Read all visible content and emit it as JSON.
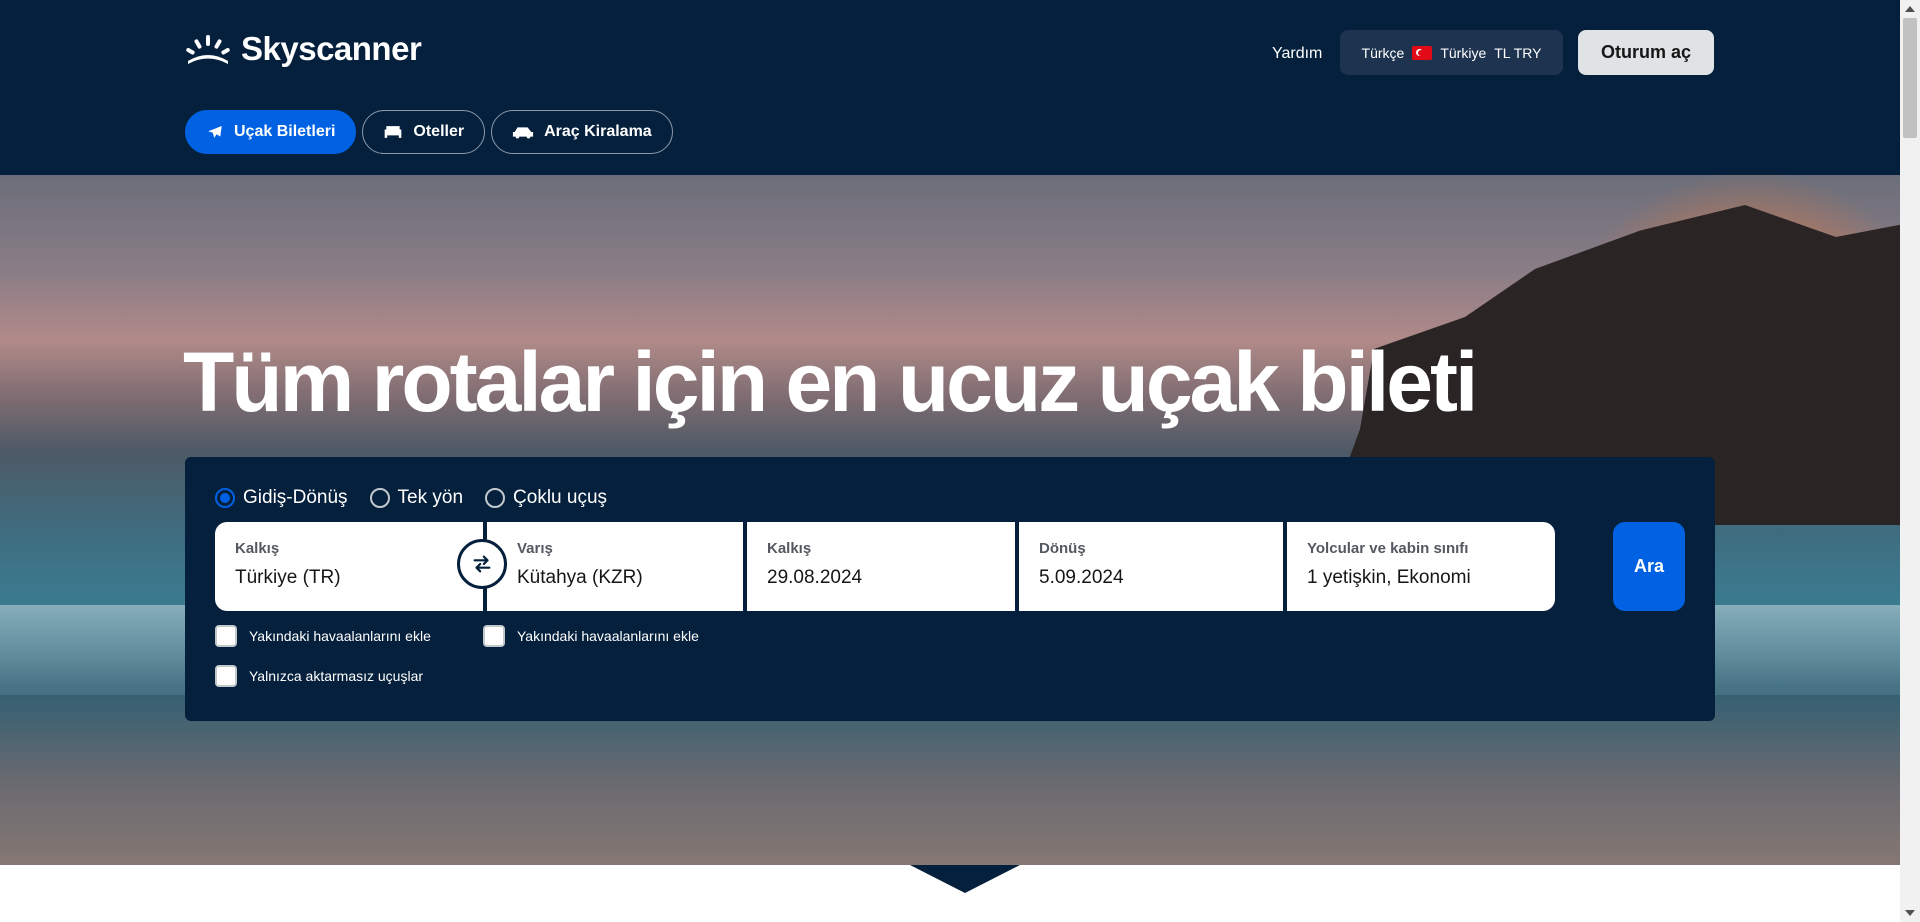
{
  "header": {
    "brand": "Skyscanner",
    "help_label": "Yardım",
    "locale": {
      "language": "Türkçe",
      "country": "Türkiye",
      "currency": "TL TRY"
    },
    "signin_label": "Oturum aç"
  },
  "nav": {
    "tabs": [
      {
        "label": "Uçak Biletleri",
        "icon": "plane-icon",
        "active": true
      },
      {
        "label": "Oteller",
        "icon": "bed-icon",
        "active": false
      },
      {
        "label": "Araç Kiralama",
        "icon": "car-icon",
        "active": false
      }
    ]
  },
  "hero": {
    "headline": "Tüm rotalar için en ucuz uçak bileti"
  },
  "search": {
    "trip_types": [
      {
        "label": "Gidiş-Dönüş",
        "selected": true
      },
      {
        "label": "Tek yön",
        "selected": false
      },
      {
        "label": "Çoklu uçuş",
        "selected": false
      }
    ],
    "from": {
      "label": "Kalkış",
      "value": "Türkiye (TR)"
    },
    "to": {
      "label": "Varış",
      "value": "Kütahya (KZR)"
    },
    "depart": {
      "label": "Kalkış",
      "value": "29.08.2024"
    },
    "return": {
      "label": "Dönüş",
      "value": "5.09.2024"
    },
    "travellers": {
      "label": "Yolcular ve kabin sınıfı",
      "value": "1 yetişkin, Ekonomi"
    },
    "search_label": "Ara",
    "nearby_from_label": "Yakındaki havaalanlarını ekle",
    "nearby_to_label": "Yakındaki havaalanlarını ekle",
    "direct_only_label": "Yalnızca aktarmasız uçuşlar"
  },
  "colors": {
    "navy": "#05203c",
    "primary": "#0062e3"
  }
}
